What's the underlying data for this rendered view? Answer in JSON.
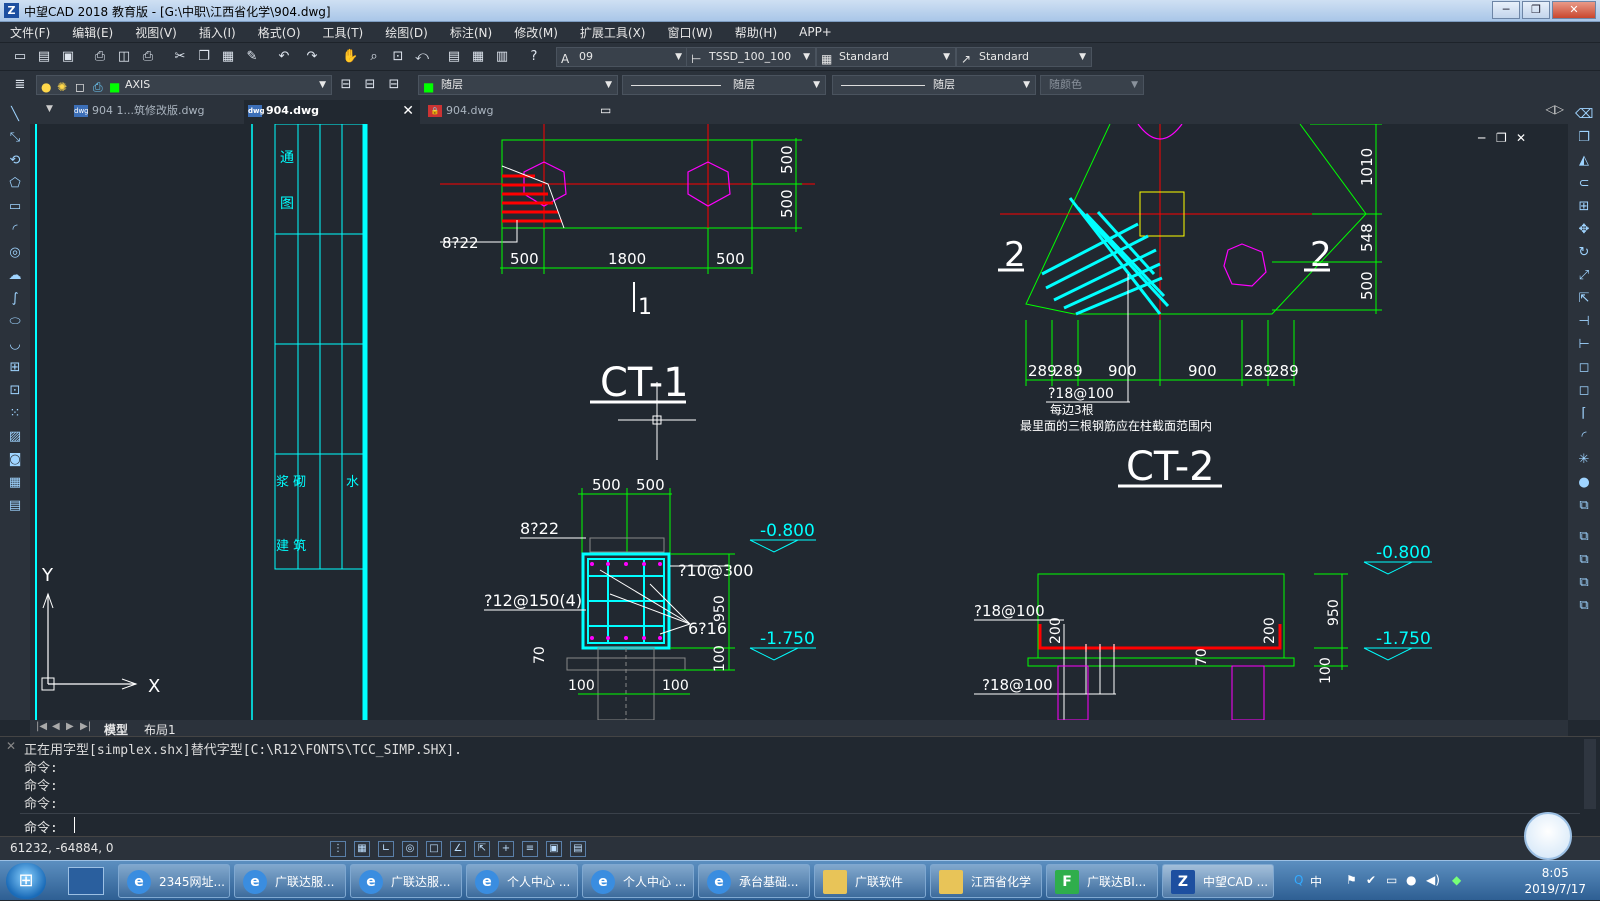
{
  "window": {
    "title": "中望CAD 2018 教育版 - [G:\\中职\\江西省化学\\904.dwg]"
  },
  "menu": [
    "文件(F)",
    "编辑(E)",
    "视图(V)",
    "插入(I)",
    "格式(O)",
    "工具(T)",
    "绘图(D)",
    "标注(N)",
    "修改(M)",
    "扩展工具(X)",
    "窗口(W)",
    "帮助(H)",
    "APP+"
  ],
  "toolbar": {
    "text_style_value": "09",
    "dim_style_value": "TSSD_100_100",
    "table_style_value": "Standard",
    "multileader_style_value": "Standard",
    "layer_value": "AXIS",
    "color_value": "随层",
    "linetype_value": "随层",
    "lineweight_value": "随层",
    "plotstyle_value": "随颜色"
  },
  "doc_tabs": [
    {
      "label": "904 1...筑修改版.dwg"
    },
    {
      "label": "904.dwg"
    },
    {
      "label": "904.dwg"
    }
  ],
  "drawing": {
    "ct1_title": "CT-1",
    "ct2_title": "CT-2",
    "section_mark_1": "1",
    "section_mark_2_left": "2",
    "section_mark_2_right": "2",
    "ct1_top_dims": [
      "500",
      "1800",
      "500"
    ],
    "ct1_side_dims": [
      "500",
      "500"
    ],
    "ct1_rebar_1": "8?22",
    "ct1_sec_top_dims": [
      "500",
      "500"
    ],
    "ct1_sec_rebar_1": "8?22",
    "ct1_sec_rebar_2": "?10@300",
    "ct1_sec_rebar_3": "?12@150(4)",
    "ct1_sec_rebar_4": "6?16",
    "ct1_sec_dims": [
      "950",
      "70",
      "100",
      "100",
      "100"
    ],
    "ct1_elev_1": "-0.800",
    "ct1_elev_2": "-1.750",
    "ct2_dims_right": [
      "1010",
      "548",
      "500"
    ],
    "ct2_dims_bottom": [
      "289",
      "289",
      "900",
      "900",
      "289",
      "289"
    ],
    "ct2_rebar_1": "?18@100",
    "ct2_note_1": "每边3根",
    "ct2_note_2": "最里面的三根钢筋应在柱截面范围内",
    "ct2_sec_rebar_1": "?18@100",
    "ct2_sec_rebar_2": "?18@100",
    "ct2_sec_dims": [
      "200",
      "200",
      "70",
      "950",
      "100"
    ],
    "ct2_elev_1": "-0.800",
    "ct2_elev_2": "-1.750",
    "ucs_x": "X",
    "ucs_y": "Y",
    "vertical_text_1": "通",
    "vertical_text_2": "图",
    "vertical_text_3": "浆 砌",
    "vertical_text_4": "建 筑",
    "vertical_text_5": "水"
  },
  "layout_tabs": [
    "模型",
    "布局1"
  ],
  "command": {
    "lines": [
      "正在用字型[simplex.shx]替代字型[C:\\R12\\FONTS\\TCC_SIMP.SHX].",
      "命令:",
      "命令:",
      "命令:"
    ],
    "prompt": "命令:"
  },
  "status": {
    "coords": "61232, -64884, 0"
  },
  "taskbar": {
    "items": [
      "2345网址...",
      "广联达服...",
      "广联达服...",
      "个人中心 ...",
      "个人中心 ...",
      "承台基础...",
      "广联软件",
      "江西省化学",
      "广联达BI...",
      "中望CAD ..."
    ],
    "time": "8:05",
    "date": "2019/7/17",
    "ime": "中"
  },
  "colors": {
    "cyan": "#00ffff",
    "green": "#00ff00",
    "red": "#ff0000",
    "magenta": "#ff00ff",
    "yellow": "#ffff00",
    "white": "#ffffff"
  }
}
